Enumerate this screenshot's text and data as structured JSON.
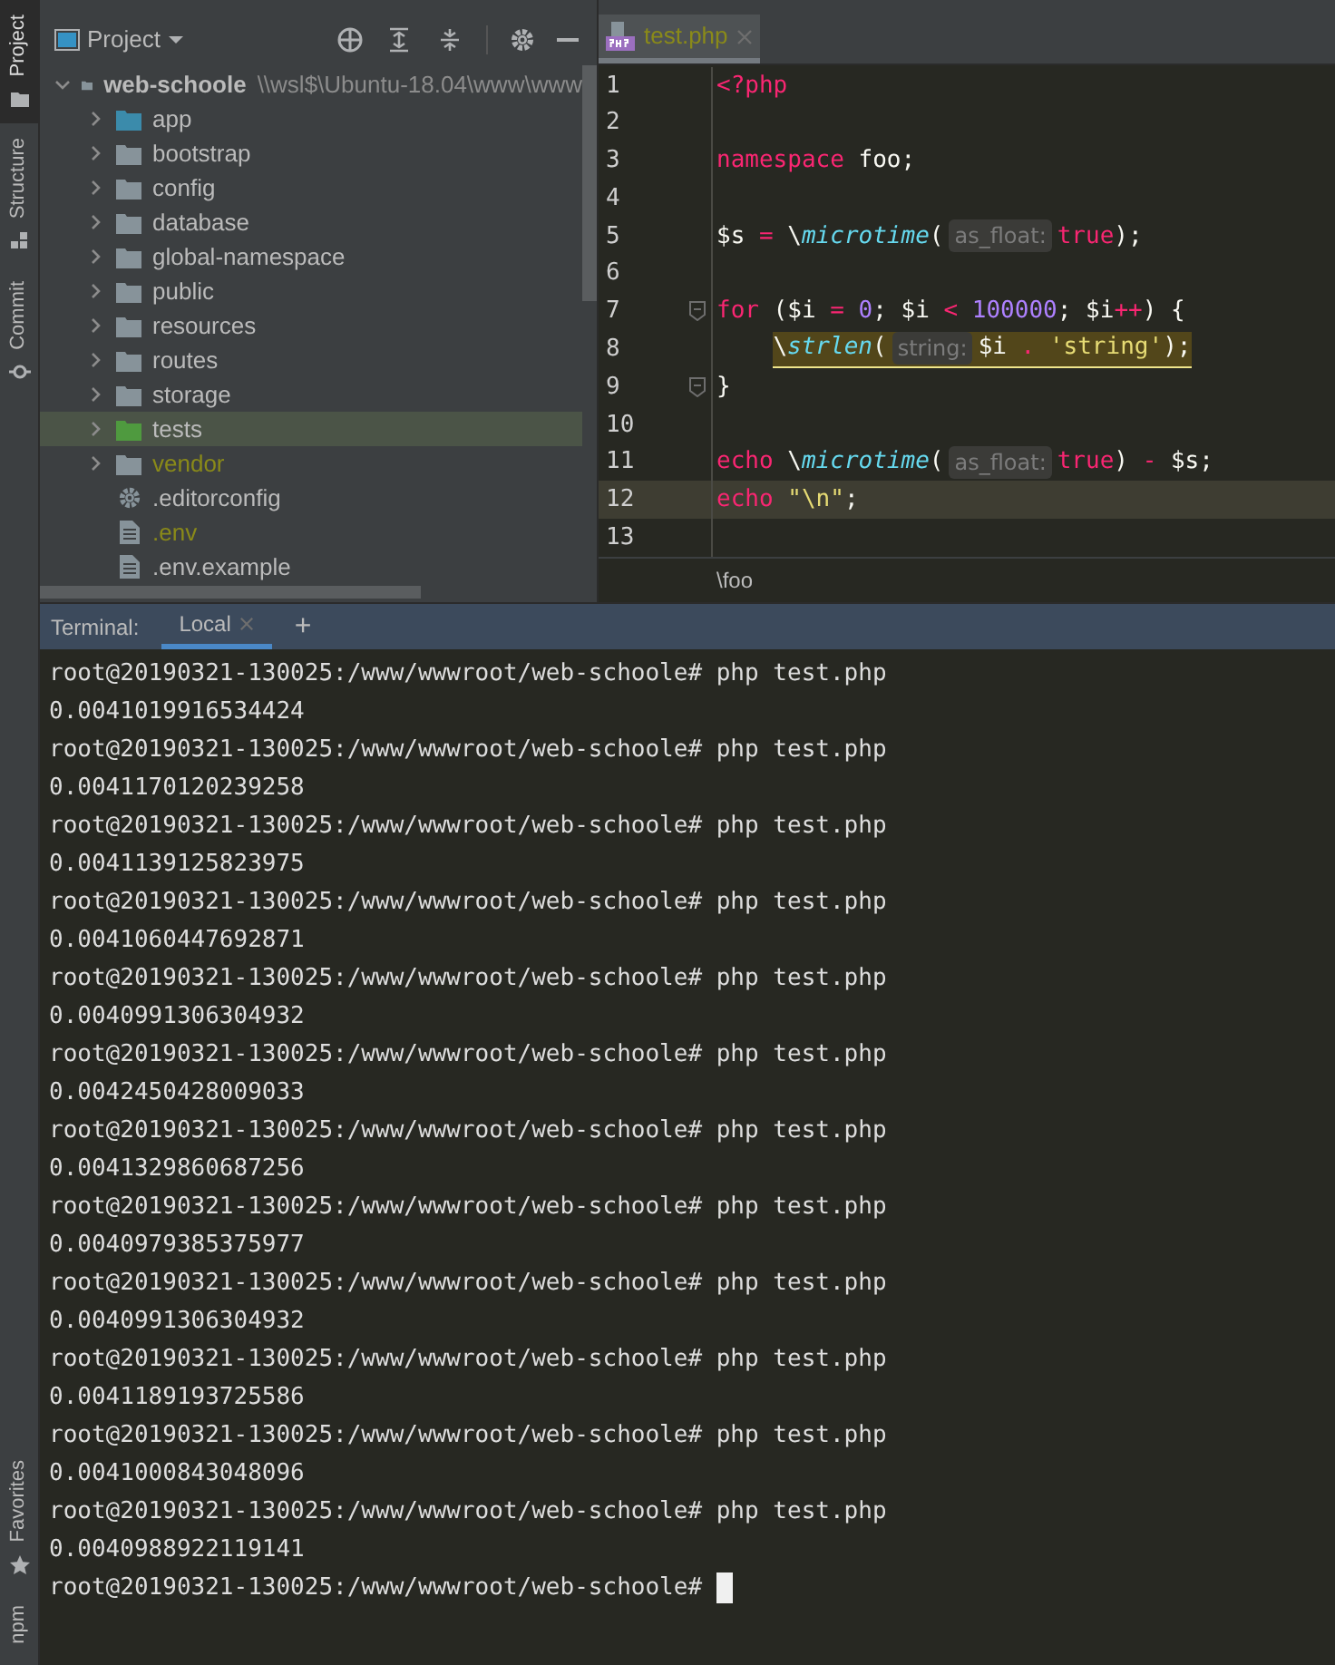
{
  "tool_strip": {
    "top": [
      {
        "label": "Project",
        "selected": true
      },
      {
        "label": "Structure",
        "selected": false
      },
      {
        "label": "Commit",
        "selected": false
      }
    ],
    "bottom": [
      {
        "label": "Favorites",
        "selected": false
      },
      {
        "label": "npm",
        "selected": false
      }
    ]
  },
  "project_panel": {
    "title": "Project",
    "tree": {
      "name": "web-schoole",
      "path": "\\\\wsl$\\Ubuntu-18.04\\www\\www",
      "expanded": true,
      "children": [
        {
          "name": "app",
          "kind": "source-folder",
          "expanded": false,
          "ignored": false,
          "selected": false
        },
        {
          "name": "bootstrap",
          "kind": "folder",
          "expanded": false,
          "ignored": false,
          "selected": false
        },
        {
          "name": "config",
          "kind": "folder",
          "expanded": false,
          "ignored": false,
          "selected": false
        },
        {
          "name": "database",
          "kind": "folder",
          "expanded": false,
          "ignored": false,
          "selected": false
        },
        {
          "name": "global-namespace",
          "kind": "folder",
          "expanded": false,
          "ignored": false,
          "selected": false
        },
        {
          "name": "public",
          "kind": "folder",
          "expanded": false,
          "ignored": false,
          "selected": false
        },
        {
          "name": "resources",
          "kind": "folder",
          "expanded": false,
          "ignored": false,
          "selected": false
        },
        {
          "name": "routes",
          "kind": "folder",
          "expanded": false,
          "ignored": false,
          "selected": false
        },
        {
          "name": "storage",
          "kind": "folder",
          "expanded": false,
          "ignored": false,
          "selected": false
        },
        {
          "name": "tests",
          "kind": "test-folder",
          "expanded": false,
          "ignored": false,
          "selected": true
        },
        {
          "name": "vendor",
          "kind": "folder",
          "expanded": false,
          "ignored": true,
          "selected": false
        },
        {
          "name": ".editorconfig",
          "kind": "config-file",
          "ignored": false,
          "selected": false
        },
        {
          "name": ".env",
          "kind": "file",
          "ignored": true,
          "selected": false
        },
        {
          "name": ".env.example",
          "kind": "file",
          "ignored": false,
          "selected": false
        }
      ]
    }
  },
  "editor": {
    "tabs": [
      {
        "label": "test.php",
        "selected": true
      }
    ],
    "lines": [
      {
        "number": "1",
        "current": false,
        "warning": false,
        "fold": false,
        "tokens": [
          {
            "text": "<?php",
            "kind": "keyword"
          }
        ]
      },
      {
        "number": "2",
        "current": false,
        "warning": false,
        "fold": false
      },
      {
        "number": "3",
        "current": false,
        "warning": false,
        "fold": false,
        "tokens": [
          {
            "text": "namespace",
            "kind": "keyword"
          },
          {
            "text": " foo;",
            "kind": "plain"
          }
        ]
      },
      {
        "number": "4",
        "current": false,
        "warning": false,
        "fold": false
      },
      {
        "number": "5",
        "current": false,
        "warning": false,
        "fold": false,
        "tokens": [
          {
            "text": "$s ",
            "kind": "plain"
          },
          {
            "text": "=",
            "kind": "keyword"
          },
          {
            "text": " \\",
            "kind": "plain"
          },
          {
            "text": "microtime",
            "kind": "function"
          },
          {
            "text": "(",
            "kind": "plain"
          },
          {
            "text": "as_float:",
            "kind": "hint"
          },
          {
            "text": "true",
            "kind": "keyword"
          },
          {
            "text": ");",
            "kind": "plain"
          }
        ]
      },
      {
        "number": "6",
        "current": false,
        "warning": false,
        "fold": false
      },
      {
        "number": "7",
        "current": false,
        "warning": false,
        "fold": true,
        "tokens": [
          {
            "text": "for",
            "kind": "keyword"
          },
          {
            "text": " ($i ",
            "kind": "plain"
          },
          {
            "text": "=",
            "kind": "keyword"
          },
          {
            "text": " 0",
            "kind": "number"
          },
          {
            "text": "; $i ",
            "kind": "plain"
          },
          {
            "text": "<",
            "kind": "keyword"
          },
          {
            "text": " 100000",
            "kind": "number"
          },
          {
            "text": "; $i",
            "kind": "plain"
          },
          {
            "text": "++",
            "kind": "keyword"
          },
          {
            "text": ") {",
            "kind": "plain"
          }
        ]
      },
      {
        "number": "8",
        "current": false,
        "warning": true,
        "fold": false,
        "tokens": [
          {
            "text": "    \\",
            "kind": "plain"
          },
          {
            "text": "strlen",
            "kind": "function"
          },
          {
            "text": "(",
            "kind": "plain"
          },
          {
            "text": "string:",
            "kind": "hint"
          },
          {
            "text": "$i ",
            "kind": "plain"
          },
          {
            "text": ".",
            "kind": "keyword"
          },
          {
            "text": " 'string'",
            "kind": "string"
          },
          {
            "text": ");",
            "kind": "plain"
          }
        ]
      },
      {
        "number": "9",
        "current": false,
        "warning": false,
        "fold": true,
        "tokens": [
          {
            "text": "}",
            "kind": "plain"
          }
        ]
      },
      {
        "number": "10",
        "current": false,
        "warning": false,
        "fold": false
      },
      {
        "number": "11",
        "current": false,
        "warning": false,
        "fold": false,
        "tokens": [
          {
            "text": "echo",
            "kind": "keyword"
          },
          {
            "text": " \\",
            "kind": "plain"
          },
          {
            "text": "microtime",
            "kind": "function"
          },
          {
            "text": "(",
            "kind": "plain"
          },
          {
            "text": "as_float:",
            "kind": "hint"
          },
          {
            "text": "true",
            "kind": "keyword"
          },
          {
            "text": ") ",
            "kind": "plain"
          },
          {
            "text": "-",
            "kind": "keyword"
          },
          {
            "text": " $s;",
            "kind": "plain"
          }
        ]
      },
      {
        "number": "12",
        "current": true,
        "warning": false,
        "fold": false,
        "tokens": [
          {
            "text": "echo",
            "kind": "keyword"
          },
          {
            "text": " \"\\n\"",
            "kind": "string"
          },
          {
            "text": ";",
            "kind": "plain"
          }
        ]
      },
      {
        "number": "13",
        "current": false,
        "warning": false,
        "fold": false
      }
    ],
    "breadcrumb": "\\foo"
  },
  "terminal": {
    "label": "Terminal:",
    "tabs": [
      {
        "label": "Local",
        "selected": true
      }
    ],
    "add": "+",
    "lines": [
      "root@20190321-130025:/www/wwwroot/web-schoole# php test.php",
      "0.0041019916534424",
      "root@20190321-130025:/www/wwwroot/web-schoole# php test.php",
      "0.0041170120239258",
      "root@20190321-130025:/www/wwwroot/web-schoole# php test.php",
      "0.0041139125823975",
      "root@20190321-130025:/www/wwwroot/web-schoole# php test.php",
      "0.0041060447692871",
      "root@20190321-130025:/www/wwwroot/web-schoole# php test.php",
      "0.0040991306304932",
      "root@20190321-130025:/www/wwwroot/web-schoole# php test.php",
      "0.0042450428009033",
      "root@20190321-130025:/www/wwwroot/web-schoole# php test.php",
      "0.0041329860687256",
      "root@20190321-130025:/www/wwwroot/web-schoole# php test.php",
      "0.0040979385375977",
      "root@20190321-130025:/www/wwwroot/web-schoole# php test.php",
      "0.0040991306304932",
      "root@20190321-130025:/www/wwwroot/web-schoole# php test.php",
      "0.0041189193725586",
      "root@20190321-130025:/www/wwwroot/web-schoole# php test.php",
      "0.0041000843048096",
      "root@20190321-130025:/www/wwwroot/web-schoole# php test.php",
      "0.0040988922119141",
      "root@20190321-130025:/www/wwwroot/web-schoole#"
    ],
    "cursor": true
  }
}
